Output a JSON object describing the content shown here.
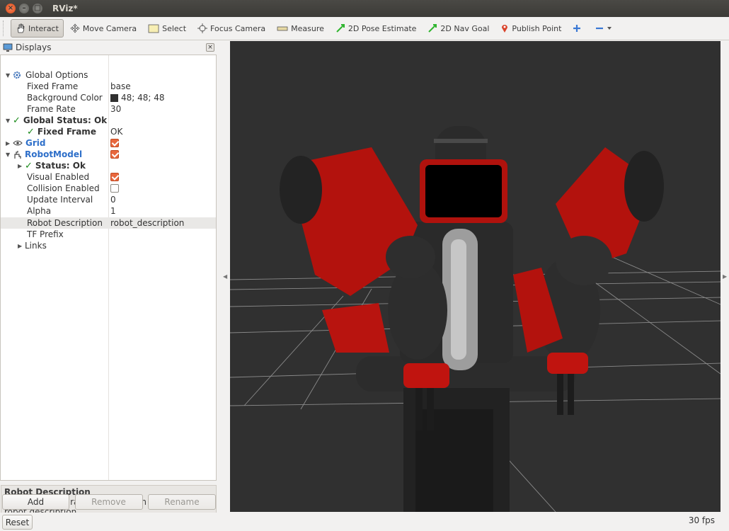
{
  "window": {
    "title": "RViz*"
  },
  "toolbar": {
    "interact": "Interact",
    "move_camera": "Move Camera",
    "select": "Select",
    "focus_camera": "Focus Camera",
    "measure": "Measure",
    "pose_estimate": "2D Pose Estimate",
    "nav_goal": "2D Nav Goal",
    "publish_point": "Publish Point"
  },
  "displays": {
    "title": "Displays",
    "rows": {
      "global_options": "Global Options",
      "fixed_frame": {
        "label": "Fixed Frame",
        "value": "base"
      },
      "background_color": {
        "label": "Background Color",
        "value": "48; 48; 48",
        "color": "#303030"
      },
      "frame_rate": {
        "label": "Frame Rate",
        "value": "30"
      },
      "global_status": "Global Status: Ok",
      "status_fixed_frame": {
        "label": "Fixed Frame",
        "value": "OK"
      },
      "grid": {
        "label": "Grid",
        "checked": true
      },
      "robot_model": {
        "label": "RobotModel",
        "checked": true
      },
      "status_ok": "Status: Ok",
      "visual_enabled": {
        "label": "Visual Enabled",
        "checked": true
      },
      "collision_enabled": {
        "label": "Collision Enabled",
        "checked": false
      },
      "update_interval": {
        "label": "Update Interval",
        "value": "0"
      },
      "alpha": {
        "label": "Alpha",
        "value": "1"
      },
      "robot_description": {
        "label": "Robot Description",
        "value": "robot_description"
      },
      "tf_prefix": {
        "label": "TF Prefix"
      },
      "links": {
        "label": "Links"
      }
    },
    "description": {
      "title": "Robot Description",
      "text": "Name of the parameter to search for to load the robot description."
    },
    "buttons": {
      "add": "Add",
      "remove": "Remove",
      "rename": "Rename"
    }
  },
  "statusbar": {
    "reset": "Reset",
    "fps": "30 fps"
  },
  "colors": {
    "accent_checkbox": "#e8673d",
    "link_blue": "#2e6fc9",
    "view_bg": "#303030",
    "robot_red": "#c8140f"
  }
}
